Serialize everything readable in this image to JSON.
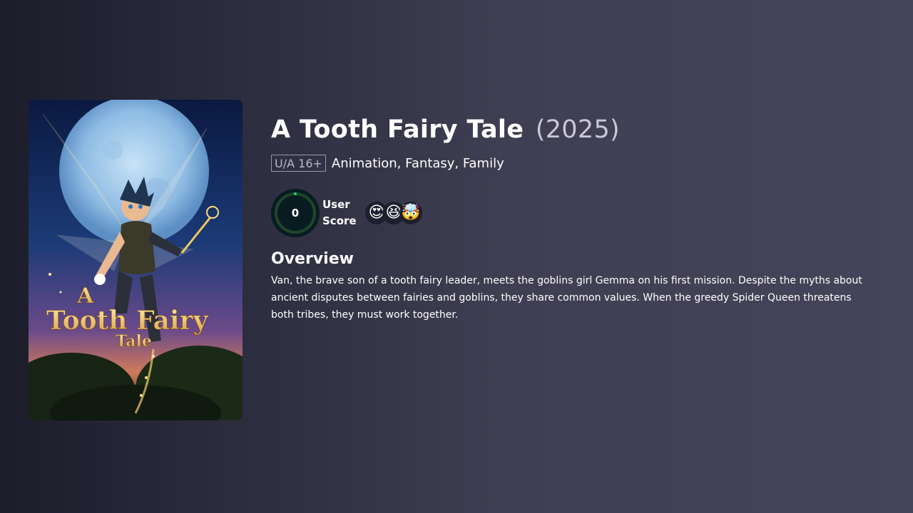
{
  "movie": {
    "title": "A Tooth Fairy Tale",
    "year": "(2025)",
    "certification": "U/A 16+",
    "genres": "Animation, Fantasy, Family",
    "user_score": "0",
    "user_score_label_line1": "User",
    "user_score_label_line2": "Score",
    "reactions": [
      "😍",
      "😆",
      "🤯"
    ],
    "overview_heading": "Overview",
    "overview": "Van, the brave son of a tooth fairy leader, meets the goblins girl Gemma on his first mission. Despite the myths about ancient disputes between fairies and goblins, they share common values. When the greedy Spider Queen threatens both tribes, they must work together."
  },
  "poster": {
    "title_line1": "A",
    "title_line2": "Tooth Fairy",
    "title_line3": "Tale",
    "icon": "movie-poster"
  },
  "colors": {
    "score_ring_track": "#204529",
    "score_ring_fill": "#21d07a",
    "score_bg": "#081c22"
  }
}
